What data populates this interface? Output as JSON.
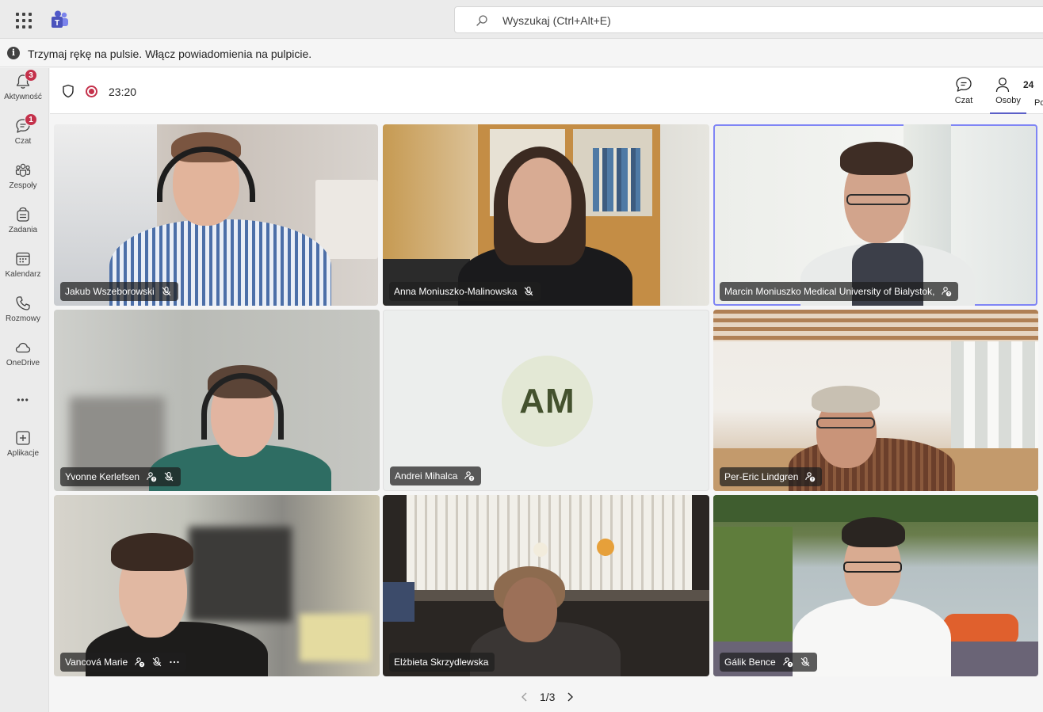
{
  "topbar": {
    "search_placeholder": "Wyszukaj (Ctrl+Alt+E)",
    "apps_icon": "waffle-icon",
    "app_logo": "teams-logo"
  },
  "notification": {
    "text": "Trzymaj rękę na pulsie. Włącz powiadomienia na pulpicie."
  },
  "rail": {
    "items": [
      {
        "label": "Aktywność",
        "icon": "bell-icon",
        "badge": "3"
      },
      {
        "label": "Czat",
        "icon": "chat-icon",
        "badge": "1"
      },
      {
        "label": "Zespoły",
        "icon": "teams-icon",
        "badge": ""
      },
      {
        "label": "Zadania",
        "icon": "tasks-icon",
        "badge": ""
      },
      {
        "label": "Kalendarz",
        "icon": "calendar-icon",
        "badge": ""
      },
      {
        "label": "Rozmowy",
        "icon": "phone-icon",
        "badge": ""
      },
      {
        "label": "OneDrive",
        "icon": "cloud-icon",
        "badge": ""
      },
      {
        "label": "Aplikacje",
        "icon": "add-app-icon",
        "badge": ""
      }
    ],
    "more": "•••"
  },
  "meeting": {
    "timer": "23:20",
    "chat_label": "Czat",
    "people_label": "Osoby",
    "people_count": "24",
    "cut_label": "Po",
    "accent": "#5b5fc7",
    "record_color": "#c4314b"
  },
  "tiles": [
    {
      "name": "Jakub Wszeborowski",
      "status": "muted",
      "avatar": ""
    },
    {
      "name": "Anna Moniuszko-Malinowska",
      "status": "muted",
      "avatar": ""
    },
    {
      "name": "Marcin Moniuszko Medical University of Bialystok,",
      "status": "guest",
      "avatar": ""
    },
    {
      "name": "Yvonne Kerlefsen",
      "status": "guest-muted",
      "avatar": ""
    },
    {
      "name": "Andrei Mihalca",
      "status": "guest",
      "avatar": "AM"
    },
    {
      "name": "Per-Eric Lindgren",
      "status": "guest",
      "avatar": ""
    },
    {
      "name": "Vancová Marie",
      "status": "guest-muted-more",
      "avatar": ""
    },
    {
      "name": "Elżbieta Skrzydlewska",
      "status": "none",
      "avatar": ""
    },
    {
      "name": "Gálik Bence",
      "status": "guest-muted",
      "avatar": ""
    }
  ],
  "pager": {
    "text": "1/3"
  }
}
